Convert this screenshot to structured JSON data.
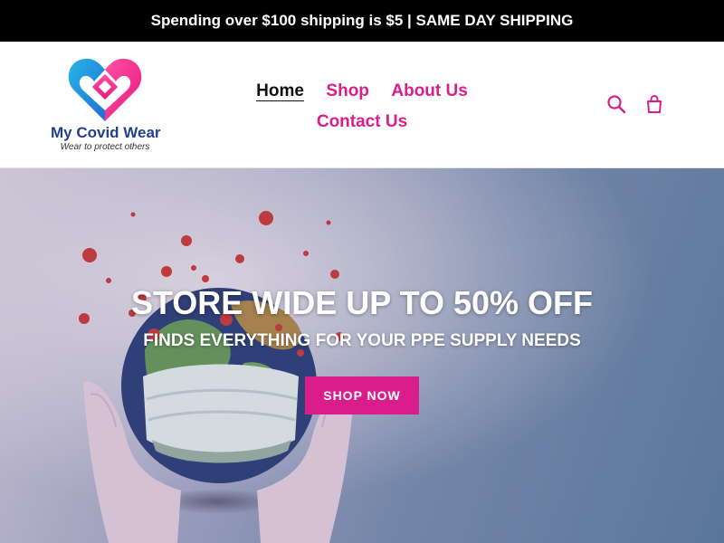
{
  "announcement": {
    "text": "Spending over $100 shipping is $5 | SAME DAY SHIPPING"
  },
  "logo": {
    "name": "My Covid Wear",
    "tagline": "Wear to protect others"
  },
  "nav": {
    "items": [
      {
        "label": "Home",
        "active": true
      },
      {
        "label": "Shop",
        "active": false
      },
      {
        "label": "About Us",
        "active": false
      },
      {
        "label": "Contact Us",
        "active": false
      }
    ]
  },
  "header_icons": {
    "search": "search-icon",
    "cart": "cart-icon"
  },
  "hero": {
    "title": "STORE WIDE UP TO 50% OFF",
    "subtitle": "FINDS EVERYTHING FOR YOUR PPE SUPPLY NEEDS",
    "cta_label": "SHOP NOW"
  },
  "colors": {
    "accent": "#d91e8c",
    "announcement_bg": "#000000",
    "logo_blue": "#1f3f8f"
  }
}
